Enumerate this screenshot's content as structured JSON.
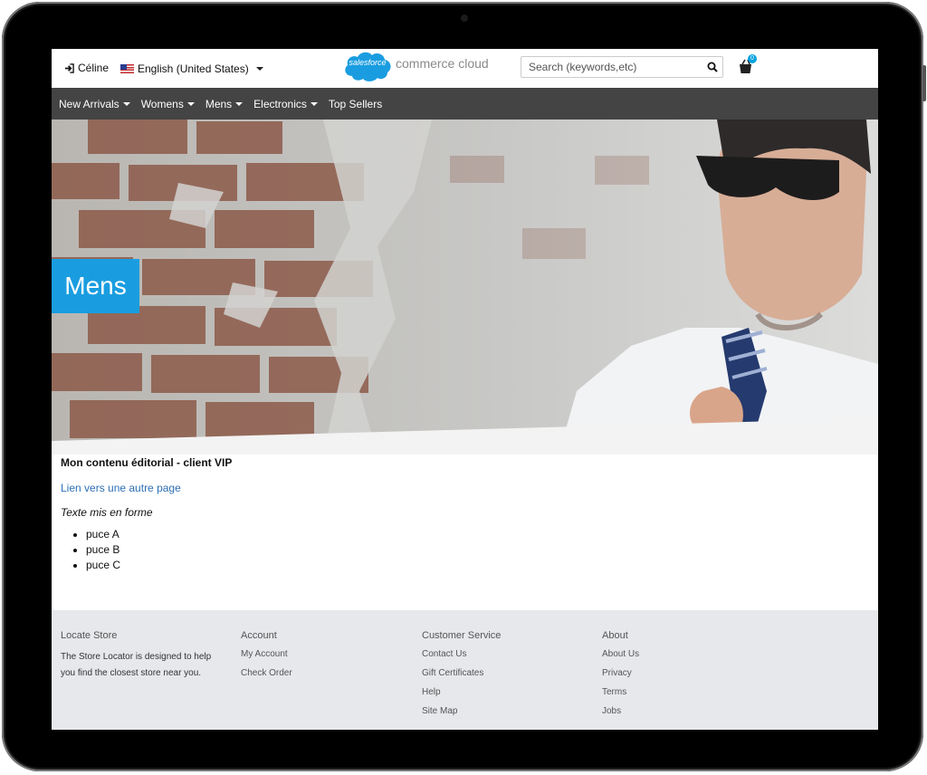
{
  "header": {
    "user_name": "Céline",
    "language": "English (United States)",
    "logo_badge": "salesforce",
    "logo_text": "commerce cloud",
    "search_placeholder": "Search (keywords,etc)",
    "cart_count": "0",
    "icons": {
      "user": "sign-in-icon",
      "flag": "us-flag-icon",
      "search": "search-icon",
      "cart": "shopping-bag-icon"
    }
  },
  "nav": {
    "items": [
      {
        "label": "New Arrivals",
        "has_dropdown": true
      },
      {
        "label": "Womens",
        "has_dropdown": true
      },
      {
        "label": "Mens",
        "has_dropdown": true
      },
      {
        "label": "Electronics",
        "has_dropdown": true
      },
      {
        "label": "Top Sellers",
        "has_dropdown": false
      }
    ]
  },
  "hero": {
    "title": "Mens"
  },
  "content": {
    "title": "Mon contenu éditorial - client VIP",
    "link": "Lien vers une autre page",
    "italic_text": "Texte mis en forme",
    "bullets": [
      "puce A",
      "puce B",
      "puce C"
    ]
  },
  "footer": {
    "locate_store": {
      "heading": "Locate Store",
      "description": "The Store Locator is designed to help you find the closest store near you."
    },
    "account": {
      "heading": "Account",
      "links": [
        "My Account",
        "Check Order"
      ]
    },
    "customer_service": {
      "heading": "Customer Service",
      "links": [
        "Contact Us",
        "Gift Certificates",
        "Help",
        "Site Map"
      ]
    },
    "about": {
      "heading": "About",
      "links": [
        "About Us",
        "Privacy",
        "Terms",
        "Jobs"
      ]
    }
  },
  "colors": {
    "nav_bg": "#444444",
    "accent": "#1a9de0",
    "link": "#2d6fb5",
    "footer_bg": "#e6e8eb"
  }
}
